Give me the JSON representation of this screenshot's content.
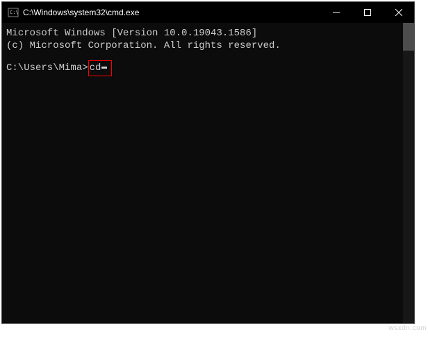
{
  "titlebar": {
    "icon_label": "cmd-icon",
    "title": "C:\\Windows\\system32\\cmd.exe"
  },
  "window_controls": {
    "minimize": "─",
    "maximize": "☐",
    "close": "✕"
  },
  "terminal": {
    "line1": "Microsoft Windows [Version 10.0.19043.1586]",
    "line2": "(c) Microsoft Corporation. All rights reserved.",
    "prompt": "C:\\Users\\Mima>",
    "command": "cd"
  },
  "watermark": "wsxdn.com"
}
